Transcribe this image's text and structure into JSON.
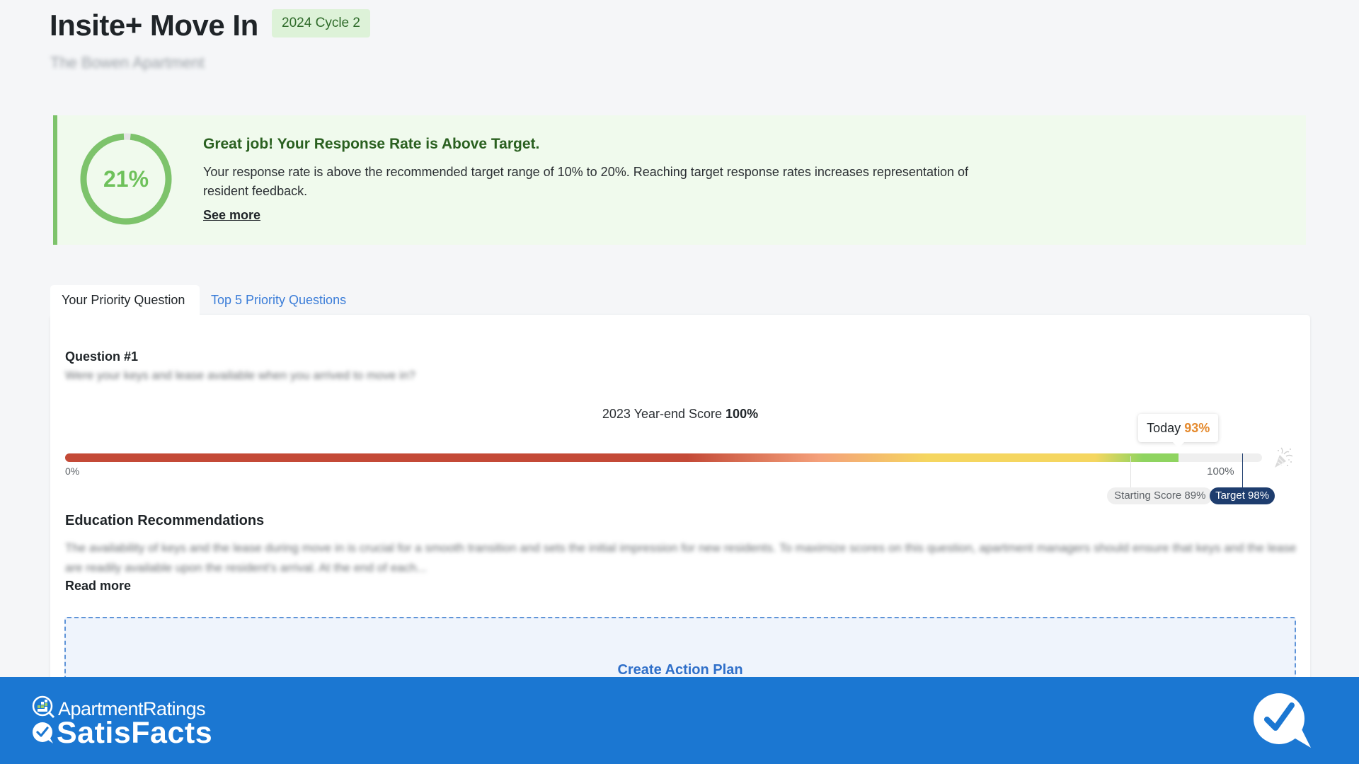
{
  "header": {
    "title": "Insite+ Move In",
    "cycle_badge": "2024 Cycle 2",
    "property_name": "The Bowen Apartment"
  },
  "response_banner": {
    "rate_percent": 21,
    "rate_label": "21%",
    "title": "Great job! Your Response Rate is Above Target.",
    "body": "Your response rate is above the recommended target range of 10% to 20%. Reaching target response rates increases representation of resident feedback.",
    "see_more": "See more",
    "colors": {
      "accent": "#7dc36b",
      "background": "#f0faed",
      "title": "#2a6020"
    }
  },
  "tabs": [
    {
      "label": "Your Priority Question",
      "active": true
    },
    {
      "label": "Top 5 Priority Questions",
      "active": false
    }
  ],
  "question": {
    "label": "Question #1",
    "text": "Were your keys and lease available when you arrived to move in?",
    "year_end_label": "2023 Year-end Score",
    "year_end_value": "100%",
    "score_bar": {
      "min_label": "0%",
      "max_label": "100%",
      "today_label": "Today",
      "today_value": 93,
      "today_text": "93%",
      "starting_label": "Starting Score 89%",
      "starting_value": 89,
      "target_label": "Target 98%",
      "target_value": 98,
      "gradient": [
        "#c44a37",
        "#c44a37",
        "#f4a07a",
        "#f5d660",
        "#f5d660",
        "#8fd460"
      ]
    }
  },
  "education": {
    "title": "Education Recommendations",
    "body": "The availability of keys and the lease during move in is crucial for a smooth transition and sets the initial impression for new residents. To maximize scores on this question, apartment managers should ensure that keys and the lease are readily available upon the resident's arrival. At the end of each...",
    "read_more": "Read more"
  },
  "actions": {
    "create_action_plan": "Create Action Plan"
  },
  "footer": {
    "brand_top": "ApartmentRatings",
    "brand_bottom": "SatisFacts",
    "background": "#1b77d2"
  }
}
